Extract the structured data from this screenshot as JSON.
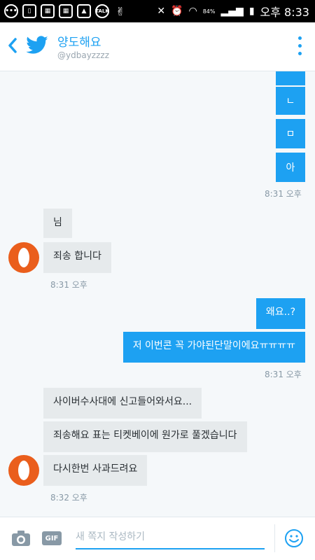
{
  "statusbar": {
    "left_icons": [
      "message-icon",
      "phone-icon",
      "app-icon-1",
      "app-icon-2",
      "gallery-icon",
      "talk-icon",
      "victory-icon"
    ],
    "talk_label": "TALK",
    "network": "84%",
    "time": "오후 8:33"
  },
  "header": {
    "name": "양도해요",
    "handle": "@ydbayzzzz",
    "brand_color": "#1da1f2"
  },
  "messages": {
    "out_chars": [
      "ㄴ",
      "ㅁ",
      "아"
    ],
    "time1": "8:31 오후",
    "in1a": "님",
    "in1b": "죄송 합니다",
    "time2": "8:31 오후",
    "out2a": "왜요..?",
    "out2b": "저 이번콘 꼭 가야된단말이에요ㅠㅠㅠㅠ",
    "time3": "8:31 오후",
    "in3a": "사이버수사대에 신고들어와서요...",
    "in3b": "죄송해요 표는 티켓베이에 원가로 풀겠습니다",
    "in3c": "다시한번 사과드려요",
    "time4": "8:32 오후"
  },
  "composer": {
    "gif_label": "GIF",
    "placeholder": "새 쪽지 작성하기"
  }
}
